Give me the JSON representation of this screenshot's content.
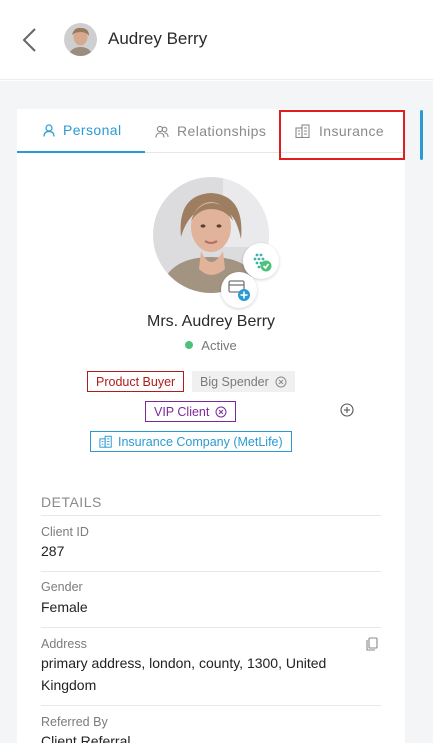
{
  "header": {
    "client_name": "Audrey Berry"
  },
  "tabs": [
    {
      "label": "Personal",
      "active": true
    },
    {
      "label": "Relationships",
      "active": false
    },
    {
      "label": "Insurance",
      "active": false
    }
  ],
  "profile": {
    "full_name": "Mrs. Audrey Berry",
    "status": "Active"
  },
  "tags": {
    "product_buyer": "Product Buyer",
    "big_spender": "Big Spender",
    "vip_client": "VIP Client",
    "insurance_company": "Insurance Company (MetLife)"
  },
  "details": {
    "section_title": "DETAILS",
    "client_id_label": "Client ID",
    "client_id": "287",
    "gender_label": "Gender",
    "gender": "Female",
    "address_label": "Address",
    "address": "primary address, london, county, 1300, United Kingdom",
    "referred_by_label": "Referred By",
    "referred_by": "Client Referral"
  },
  "colors": {
    "accent": "#2a9bd1",
    "product_buyer": "#b01c1c",
    "vip_client": "#7b2a9b",
    "status_active": "#4cc27a",
    "highlight": "#e11d1d"
  }
}
